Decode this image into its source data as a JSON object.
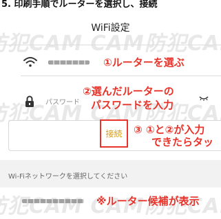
{
  "top_strip": {
    "text": "5. 印刷手順でルーターを選択し、接続"
  },
  "screen": {
    "title": "WiFi設定"
  },
  "watermark": {
    "text": "防犯CAM CAM"
  },
  "network_row": {
    "icon": "wifi-icon",
    "ssid_masked": true,
    "annotation": "①ルーターを選ぶ"
  },
  "password_row": {
    "icon": "lock-icon",
    "label": "パスワード",
    "toggle_icon": "eye-closed-icon",
    "annotation_line1": "②選んだルーターの",
    "annotation_line2": "パスワードを入力"
  },
  "connect": {
    "label": "接続",
    "annotation_line1": "③ ①と②が入力",
    "annotation_line2": "できたらタッ"
  },
  "networks_section": {
    "label": "Wi-Fiネットワークを選択してください"
  },
  "candidate_row": {
    "ssid_masked": true,
    "annotation": "※ルーター候補が表示"
  },
  "colors": {
    "annotation": "#e8332a",
    "connect_text": "#d69b1b",
    "highlight_box": "#e8332a"
  }
}
